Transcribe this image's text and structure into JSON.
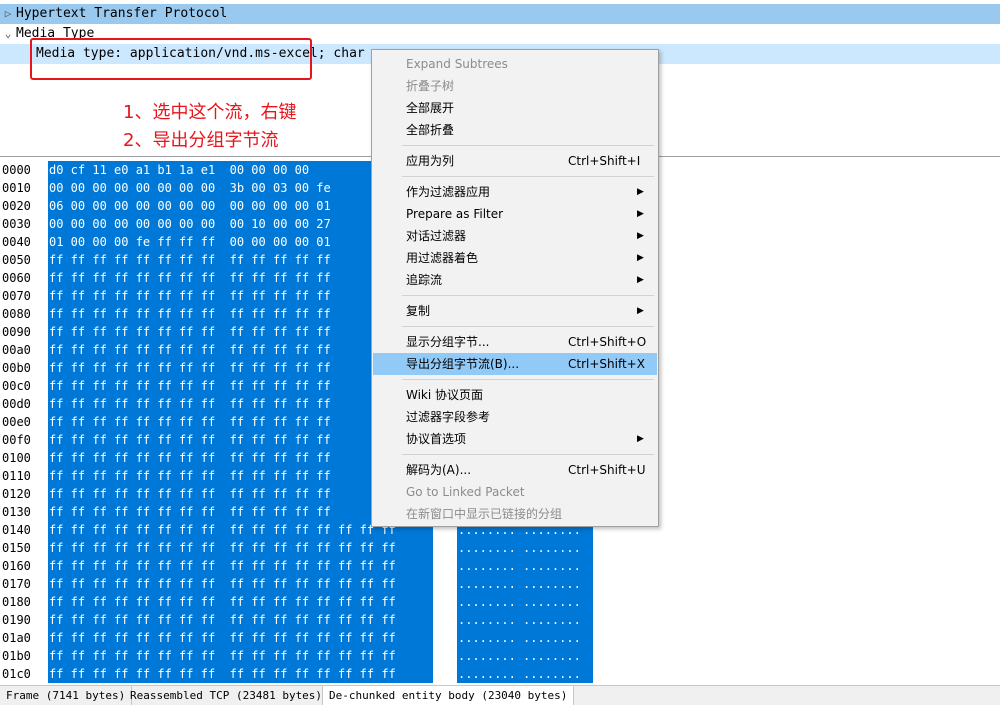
{
  "tree": {
    "rows": [
      {
        "text": "Hypertext Transfer Protocol",
        "expander": "▷"
      },
      {
        "text": "Media Type",
        "expander": "⌄"
      },
      {
        "text": "Media type: application/vnd.ms-excel; char",
        "expander": ""
      }
    ]
  },
  "annotation": {
    "line1": "1、选中这个流，右键",
    "line2": "2、导出分组字节流"
  },
  "hex": {
    "offsets": [
      "0000",
      "0010",
      "0020",
      "0030",
      "0040",
      "0050",
      "0060",
      "0070",
      "0080",
      "0090",
      "00a0",
      "00b0",
      "00c0",
      "00d0",
      "00e0",
      "00f0",
      "0100",
      "0110",
      "0120",
      "0130",
      "0140",
      "0150",
      "0160",
      "0170",
      "0180",
      "0190",
      "01a0",
      "01b0",
      "01c0"
    ],
    "bytes": [
      "d0 cf 11 e0 a1 b1 1a e1  00 00 00 00",
      "00 00 00 00 00 00 00 00  3b 00 03 00 fe",
      "06 00 00 00 00 00 00 00  00 00 00 00 01",
      "00 00 00 00 00 00 00 00  00 10 00 00 27",
      "01 00 00 00 fe ff ff ff  00 00 00 00 01",
      "ff ff ff ff ff ff ff ff  ff ff ff ff ff",
      "ff ff ff ff ff ff ff ff  ff ff ff ff ff",
      "ff ff ff ff ff ff ff ff  ff ff ff ff ff",
      "ff ff ff ff ff ff ff ff  ff ff ff ff ff",
      "ff ff ff ff ff ff ff ff  ff ff ff ff ff",
      "ff ff ff ff ff ff ff ff  ff ff ff ff ff",
      "ff ff ff ff ff ff ff ff  ff ff ff ff ff",
      "ff ff ff ff ff ff ff ff  ff ff ff ff ff",
      "ff ff ff ff ff ff ff ff  ff ff ff ff ff",
      "ff ff ff ff ff ff ff ff  ff ff ff ff ff",
      "ff ff ff ff ff ff ff ff  ff ff ff ff ff",
      "ff ff ff ff ff ff ff ff  ff ff ff ff ff",
      "ff ff ff ff ff ff ff ff  ff ff ff ff ff",
      "ff ff ff ff ff ff ff ff  ff ff ff ff ff",
      "ff ff ff ff ff ff ff ff  ff ff ff ff ff",
      "ff ff ff ff ff ff ff ff  ff ff ff ff ff ff ff ff",
      "ff ff ff ff ff ff ff ff  ff ff ff ff ff ff ff ff",
      "ff ff ff ff ff ff ff ff  ff ff ff ff ff ff ff ff",
      "ff ff ff ff ff ff ff ff  ff ff ff ff ff ff ff ff",
      "ff ff ff ff ff ff ff ff  ff ff ff ff ff ff ff ff",
      "ff ff ff ff ff ff ff ff  ff ff ff ff ff ff ff ff",
      "ff ff ff ff ff ff ff ff  ff ff ff ff ff ff ff ff",
      "ff ff ff ff ff ff ff ff  ff ff ff ff ff ff ff ff",
      "ff ff ff ff ff ff ff ff  ff ff ff ff ff ff ff ff"
    ],
    "ascii": [
      "",
      "",
      "",
      "",
      "",
      "",
      "",
      "",
      "",
      "",
      "",
      "",
      "",
      "",
      "",
      "",
      "",
      "",
      "",
      "",
      "........ ........",
      "........ ........",
      "........ ........",
      "........ ........",
      "........ ........",
      "........ ........",
      "........ ........",
      "........ ........",
      "........ ........"
    ]
  },
  "context_menu": {
    "items": [
      {
        "label": "Expand Subtrees",
        "shortcut": "",
        "submenu": false,
        "disabled": true,
        "highlighted": false
      },
      {
        "label": "折叠子树",
        "shortcut": "",
        "submenu": false,
        "disabled": true,
        "highlighted": false
      },
      {
        "label": "全部展开",
        "shortcut": "",
        "submenu": false,
        "disabled": false,
        "highlighted": false
      },
      {
        "label": "全部折叠",
        "shortcut": "",
        "submenu": false,
        "disabled": false,
        "highlighted": false
      },
      {
        "separator": true
      },
      {
        "label": "应用为列",
        "shortcut": "Ctrl+Shift+I",
        "submenu": false,
        "disabled": false,
        "highlighted": false
      },
      {
        "separator": true
      },
      {
        "label": "作为过滤器应用",
        "shortcut": "",
        "submenu": true,
        "disabled": false,
        "highlighted": false
      },
      {
        "label": "Prepare as Filter",
        "shortcut": "",
        "submenu": true,
        "disabled": false,
        "highlighted": false
      },
      {
        "label": "对话过滤器",
        "shortcut": "",
        "submenu": true,
        "disabled": false,
        "highlighted": false
      },
      {
        "label": "用过滤器着色",
        "shortcut": "",
        "submenu": true,
        "disabled": false,
        "highlighted": false
      },
      {
        "label": "追踪流",
        "shortcut": "",
        "submenu": true,
        "disabled": false,
        "highlighted": false
      },
      {
        "separator": true
      },
      {
        "label": "复制",
        "shortcut": "",
        "submenu": true,
        "disabled": false,
        "highlighted": false
      },
      {
        "separator": true
      },
      {
        "label": "显示分组字节...",
        "shortcut": "Ctrl+Shift+O",
        "submenu": false,
        "disabled": false,
        "highlighted": false
      },
      {
        "label": "导出分组字节流(B)...",
        "shortcut": "Ctrl+Shift+X",
        "submenu": false,
        "disabled": false,
        "highlighted": true
      },
      {
        "separator": true
      },
      {
        "label": "Wiki 协议页面",
        "shortcut": "",
        "submenu": false,
        "disabled": false,
        "highlighted": false
      },
      {
        "label": "过滤器字段参考",
        "shortcut": "",
        "submenu": false,
        "disabled": false,
        "highlighted": false
      },
      {
        "label": "协议首选项",
        "shortcut": "",
        "submenu": true,
        "disabled": false,
        "highlighted": false
      },
      {
        "separator": true
      },
      {
        "label": "解码为(A)...",
        "shortcut": "Ctrl+Shift+U",
        "submenu": false,
        "disabled": false,
        "highlighted": false
      },
      {
        "label": "Go to Linked Packet",
        "shortcut": "",
        "submenu": false,
        "disabled": true,
        "highlighted": false
      },
      {
        "label": "在新窗口中显示已链接的分组",
        "shortcut": "",
        "submenu": false,
        "disabled": true,
        "highlighted": false
      }
    ],
    "submenu_arrow": "▶"
  },
  "status_tabs": [
    {
      "label": "Frame (7141 bytes)",
      "active": false
    },
    {
      "label": "Reassembled TCP (23481 bytes)",
      "active": false
    },
    {
      "label": "De-chunked entity body (23040 bytes)",
      "active": true
    }
  ],
  "colors": {
    "hex_selection": "#0078d7",
    "tree_selection": "#cce8ff",
    "menu_highlight": "#91c9f7",
    "annotation": "#e8141b"
  }
}
